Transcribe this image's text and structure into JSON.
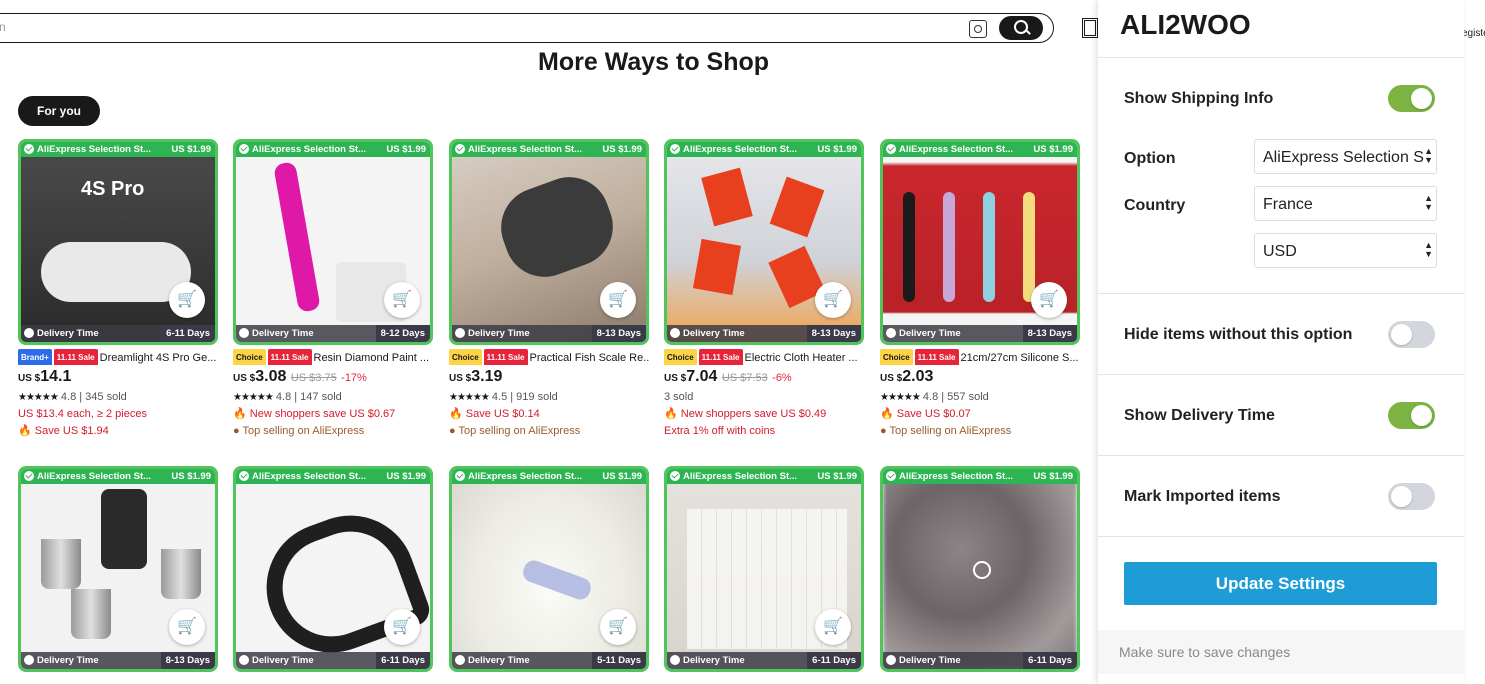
{
  "header": {
    "search_placeholder": "n",
    "register_text": "egiste"
  },
  "page": {
    "heading": "More Ways to Shop",
    "tab_for_you": "For you"
  },
  "products_row1": [
    {
      "badge": "AliExpress Selection St...",
      "badge_price": "US $1.99",
      "delivery": "Delivery Time",
      "days": "6-11 Days",
      "tag1": "Brand+",
      "tag2": "11.11 Sale",
      "title": "Dreamlight 4S Pro Ge...",
      "price_us": "US $",
      "price": "14.1",
      "old": "",
      "pct": "",
      "rating": "4.8",
      "sold": "345 sold",
      "line1": "US $13.4 each, ≥ 2 pieces",
      "line2": "Save US $1.94",
      "line2_color": "red"
    },
    {
      "badge": "AliExpress Selection St...",
      "badge_price": "US $1.99",
      "delivery": "Delivery Time",
      "days": "8-12 Days",
      "tag1": "Choice",
      "tag2": "11.11 Sale",
      "title": "Resin Diamond Paint ...",
      "price_us": "US $",
      "price": "3.08",
      "old": "US $3.75",
      "pct": "-17%",
      "rating": "4.8",
      "sold": "147 sold",
      "line1": "New shoppers save US $0.67",
      "line2": "Top selling on AliExpress",
      "line2_color": "orange"
    },
    {
      "badge": "AliExpress Selection St...",
      "badge_price": "US $1.99",
      "delivery": "Delivery Time",
      "days": "8-13 Days",
      "tag1": "Choice",
      "tag2": "11.11 Sale",
      "title": "Practical Fish Scale Re...",
      "price_us": "US $",
      "price": "3.19",
      "old": "",
      "pct": "",
      "rating": "4.5",
      "sold": "919 sold",
      "line1": "Save US $0.14",
      "line2": "Top selling on AliExpress",
      "line2_color": "orange"
    },
    {
      "badge": "AliExpress Selection St...",
      "badge_price": "US $1.99",
      "delivery": "Delivery Time",
      "days": "8-13 Days",
      "tag1": "Choice",
      "tag2": "11.11 Sale",
      "title": "Electric Cloth Heater ...",
      "price_us": "US $",
      "price": "7.04",
      "old": "US $7.53",
      "pct": "-6%",
      "rating": "",
      "sold": "3 sold",
      "line1": "New shoppers save US $0.49",
      "line2": "Extra 1% off with coins",
      "line2_color": "red"
    },
    {
      "badge": "AliExpress Selection St...",
      "badge_price": "US $1.99",
      "delivery": "Delivery Time",
      "days": "8-13 Days",
      "tag1": "Choice",
      "tag2": "11.11 Sale",
      "title": "21cm/27cm Silicone S...",
      "price_us": "US $",
      "price": "2.03",
      "old": "",
      "pct": "",
      "rating": "4.8",
      "sold": "557 sold",
      "line1": "Save US $0.07",
      "line2": "Top selling on AliExpress",
      "line2_color": "orange"
    }
  ],
  "products_row2": [
    {
      "badge": "AliExpress Selection St...",
      "badge_price": "US $1.99",
      "delivery": "Delivery Time",
      "days": "8-13 Days"
    },
    {
      "badge": "AliExpress Selection St...",
      "badge_price": "US $1.99",
      "delivery": "Delivery Time",
      "days": "6-11 Days"
    },
    {
      "badge": "AliExpress Selection St...",
      "badge_price": "US $1.99",
      "delivery": "Delivery Time",
      "days": "5-11 Days"
    },
    {
      "badge": "AliExpress Selection St...",
      "badge_price": "US $1.99",
      "delivery": "Delivery Time",
      "days": "6-11 Days"
    },
    {
      "badge": "AliExpress Selection St...",
      "badge_price": "US $1.99",
      "delivery": "Delivery Time",
      "days": "6-11 Days"
    }
  ],
  "extension": {
    "logo_text": "ALI2WOO",
    "show_shipping_label": "Show Shipping Info",
    "show_shipping_on": true,
    "option_label": "Option",
    "option_value": "AliExpress Selection S",
    "country_label": "Country",
    "country_value": "France",
    "currency_value": "USD",
    "hide_items_label": "Hide items without this option",
    "hide_items_on": false,
    "show_delivery_label": "Show Delivery Time",
    "show_delivery_on": true,
    "mark_imported_label": "Mark Imported items",
    "mark_imported_on": false,
    "update_button": "Update Settings",
    "footer_note": "Make sure to save changes"
  },
  "colors": {
    "toggle_on": "#7cb342",
    "toggle_off": "#d3d6dc",
    "update_button": "#1e9cd6",
    "badge_green": "#2fb454",
    "sale_red": "#e8243a"
  }
}
